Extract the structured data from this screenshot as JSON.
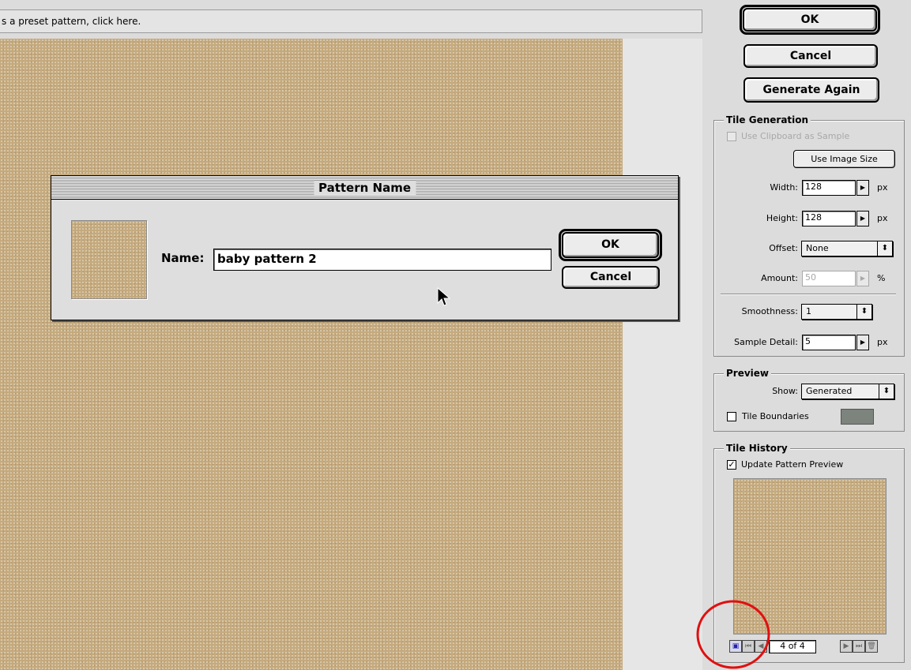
{
  "hint": {
    "text": "s a preset pattern, click here."
  },
  "right_panel": {
    "ok_label": "OK",
    "cancel_label": "Cancel",
    "generate_again_label": "Generate Again",
    "tile_generation": {
      "title": "Tile Generation",
      "use_clipboard_label": "Use Clipboard as Sample",
      "use_image_size_label": "Use Image Size",
      "width_label": "Width:",
      "width_value": "128",
      "height_label": "Height:",
      "height_value": "128",
      "unit_px": "px",
      "offset_label": "Offset:",
      "offset_value": "None",
      "amount_label": "Amount:",
      "amount_value": "50",
      "unit_percent": "%",
      "smoothness_label": "Smoothness:",
      "smoothness_value": "1",
      "sample_detail_label": "Sample Detail:",
      "sample_detail_value": "5"
    },
    "preview": {
      "title": "Preview",
      "show_label": "Show:",
      "show_value": "Generated",
      "tile_boundaries_label": "Tile Boundaries",
      "tile_boundaries_color": "#7d837d"
    },
    "tile_history": {
      "title": "Tile History",
      "update_preview_label": "Update Pattern Preview",
      "update_preview_checked": true,
      "check_mark": "✓",
      "counter": "4 of 4"
    }
  },
  "dialog": {
    "title": "Pattern Name",
    "name_label": "Name:",
    "name_value": "baby pattern 2",
    "ok_label": "OK",
    "cancel_label": "Cancel"
  },
  "colors": {
    "texture": "#c5aa7e",
    "highlight_circle": "#e01010"
  },
  "icons": {
    "save_preset": "floppy-disk-icon",
    "first": "first-tile-icon",
    "prev": "previous-tile-icon",
    "next": "next-tile-icon",
    "last": "last-tile-icon",
    "delete": "trash-icon",
    "cursor": "arrow-cursor-icon"
  }
}
